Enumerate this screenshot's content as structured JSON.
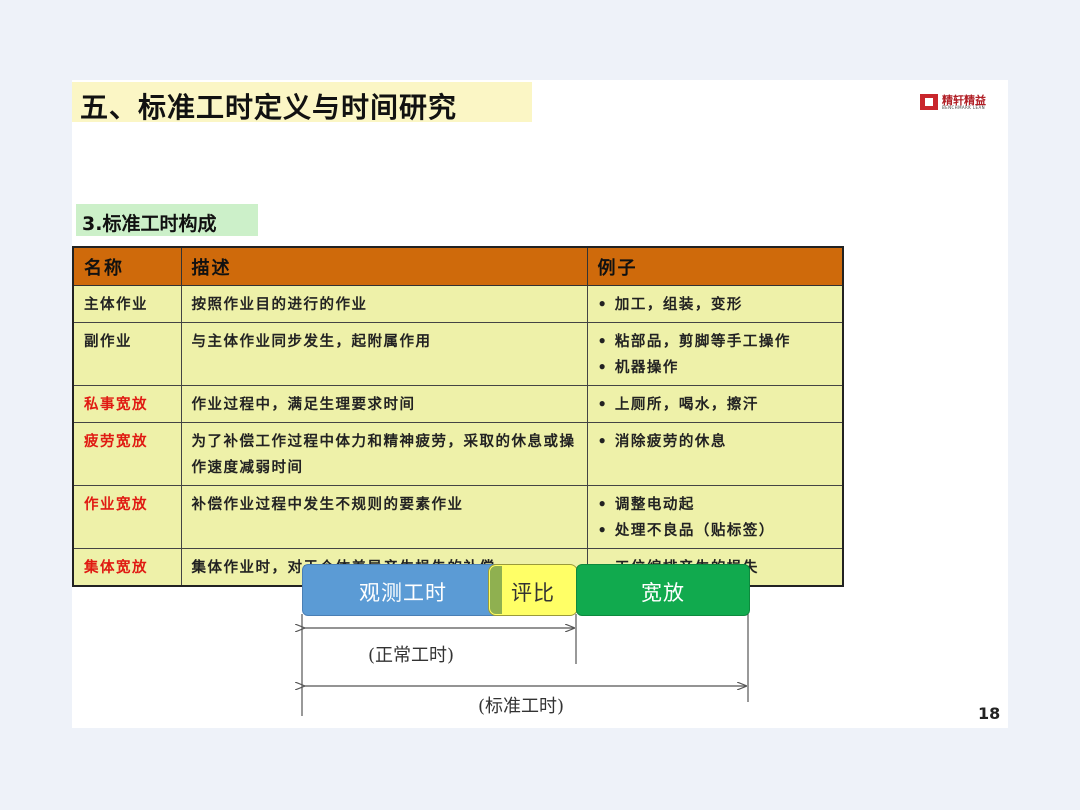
{
  "title": "五、标准工时定义与时间研究",
  "logo": {
    "cn": "精轩精益",
    "en": "BENCHMARK LEAN"
  },
  "subtitle": "3.标准工时构成",
  "table": {
    "headers": [
      "名称",
      "描述",
      "例子"
    ],
    "rows": [
      {
        "name": "主体作业",
        "desc": "按照作业目的进行的作业",
        "examples": [
          "• 加工，组装，变形"
        ],
        "highlight": false
      },
      {
        "name": "副作业",
        "desc": "与主体作业同步发生，起附属作用",
        "examples": [
          "• 粘部品，剪脚等手工操作",
          "• 机器操作"
        ],
        "highlight": false
      },
      {
        "name": "私事宽放",
        "desc": "作业过程中，满足生理要求时间",
        "examples": [
          "• 上厕所，喝水，擦汗"
        ],
        "highlight": true
      },
      {
        "name": "疲劳宽放",
        "desc": "为了补偿工作过程中体力和精神疲劳，采取的休息或操作速度减弱时间",
        "examples": [
          "• 消除疲劳的休息"
        ],
        "highlight": true
      },
      {
        "name": "作业宽放",
        "desc": "补偿作业过程中发生不规则的要素作业",
        "examples": [
          "• 调整电动起",
          "• 处理不良品（贴标签）"
        ],
        "highlight": true
      },
      {
        "name": "集体宽放",
        "desc": "集体作业时，对于个体差异产生损失的补偿",
        "examples": [
          "• 工位编排产生的损失"
        ],
        "highlight": true
      }
    ]
  },
  "diagram": {
    "observed": "观测工时",
    "rating": "评比",
    "allowance": "宽放",
    "normal_time": "(正常工时)",
    "standard_time": "(标准工时)"
  },
  "colors": {
    "header_bg": "#cf6a0b",
    "cell_bg": "#eef1a9",
    "highlight_text": "#e01a12",
    "observed": "#5b9bd5",
    "rating": "#ffff66",
    "allowance": "#11aa4e"
  },
  "page_number": "18"
}
